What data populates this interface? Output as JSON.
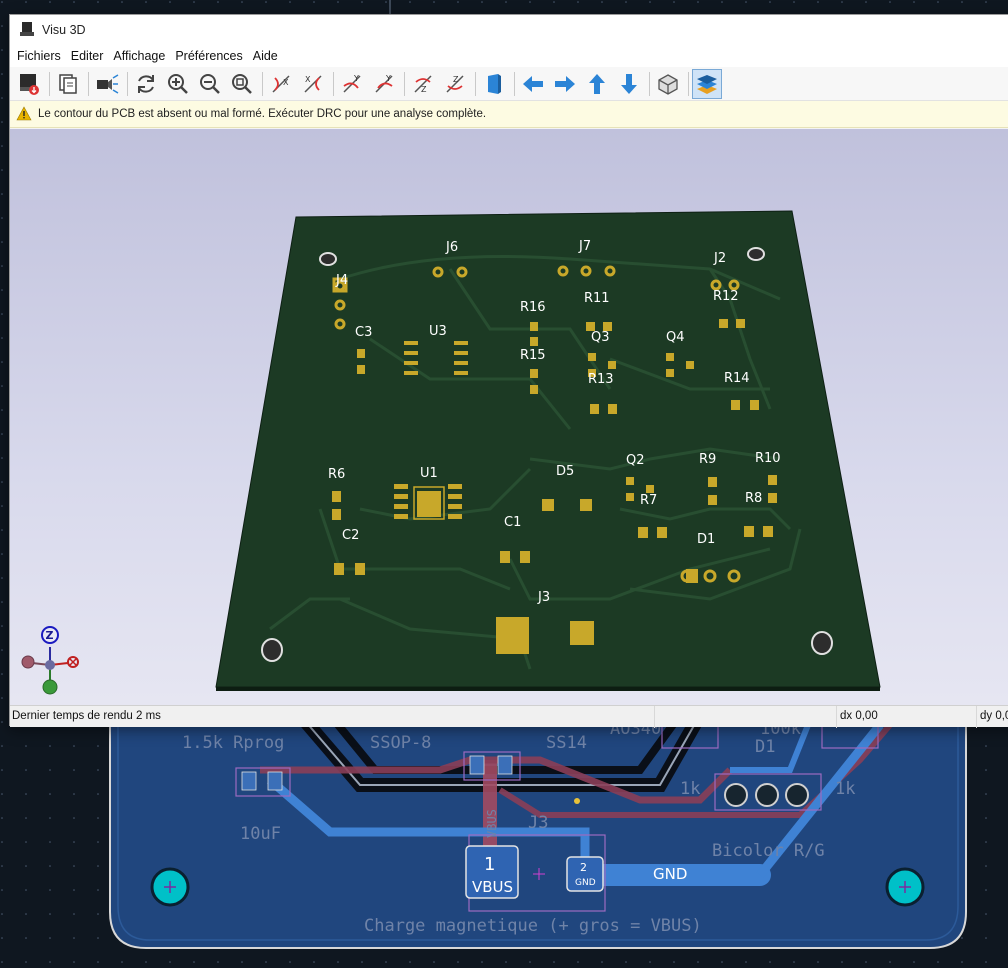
{
  "window": {
    "title": "Visu 3D"
  },
  "menu": [
    "Fichiers",
    "Editer",
    "Affichage",
    "Préférences",
    "Aide"
  ],
  "warning": "Le contour du PCB est absent ou mal formé. Exécuter DRC pour une analyse complète.",
  "toolbar_icons": [
    "render-export-icon",
    "copy-icon",
    "raytrace-icon",
    "reload-icon",
    "zoom-in-icon",
    "zoom-out-icon",
    "zoom-fit-icon",
    "rotate-x-cw-icon",
    "rotate-x-ccw-icon",
    "rotate-y-cw-icon",
    "rotate-y-ccw-icon",
    "rotate-z-cw-icon",
    "rotate-z-ccw-icon",
    "flip-board-icon",
    "pan-left-icon",
    "pan-right-icon",
    "pan-up-icon",
    "pan-down-icon",
    "ortho-icon",
    "layers-icon"
  ],
  "axes": {
    "x": "",
    "y": "",
    "z": "Z"
  },
  "status": {
    "render_time": "Dernier temps de rendu 2 ms",
    "dx": "dx 0,00",
    "dy": "dy 0,0"
  },
  "pcb3d": {
    "labels": {
      "j6": "J6",
      "j7": "J7",
      "j2": "J2",
      "j4": "J4",
      "r16": "R16",
      "r11": "R11",
      "r12": "R12",
      "c3": "C3",
      "u3": "U3",
      "q3": "Q3",
      "q4": "Q4",
      "r15": "R15",
      "r13": "R13",
      "r14": "R14",
      "q2": "Q2",
      "r9": "R9",
      "r10": "R10",
      "r6": "R6",
      "u1": "U1",
      "d5": "D5",
      "r7": "R7",
      "r8": "R8",
      "c2": "C2",
      "c1": "C1",
      "d1": "D1",
      "j3": "J3"
    }
  },
  "editor": {
    "silk_1": "1.5k Rprog",
    "silk_2": "SSOP-8",
    "silk_3": "SS14",
    "silk_4": "AO340",
    "silk_5": "1k",
    "silk_6": "100k",
    "silk_7": "D1",
    "silk_8": "1k",
    "silk_9": "1k",
    "silk_10": "10uF",
    "silk_11": "J3",
    "silk_12": "VBUS",
    "silk_13": "Bicolor R/G",
    "silk_14": "Charge magnetique (+ gros = VBUS)",
    "pad1_num": "1",
    "pad1_net": "VBUS",
    "pad2_num": "2",
    "pad2_net": "GND",
    "track_net": "GND"
  },
  "colors": {
    "board": "#1c3a24",
    "copper": "#c8a82a",
    "accent": "#0078d7",
    "warning": "#e8b400"
  }
}
